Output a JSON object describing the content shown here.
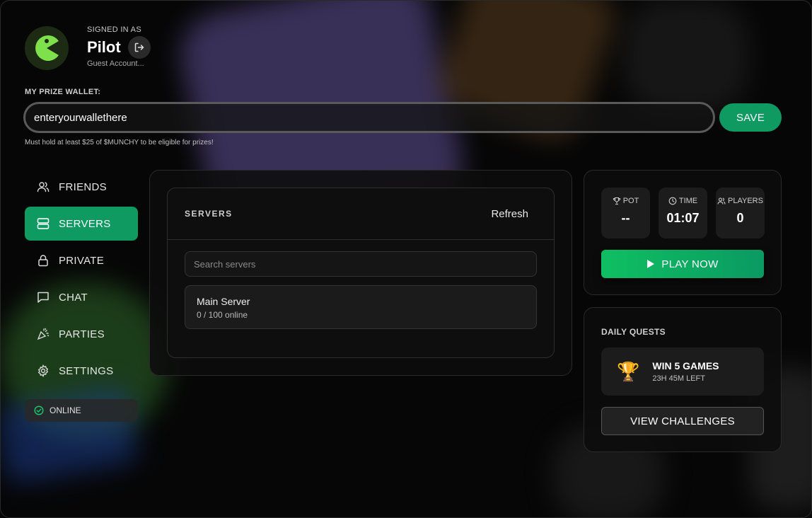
{
  "profile": {
    "signed_in_label": "SIGNED IN AS",
    "username": "Pilot",
    "account_type": "Guest Account...",
    "avatar_icon": "pacman-icon",
    "logout_icon": "logout-icon"
  },
  "wallet": {
    "label": "MY PRIZE WALLET:",
    "value": "enteryourwallethere",
    "save_label": "SAVE",
    "note": "Must hold at least $25 of $MUNCHY to be eligible for prizes!"
  },
  "sidebar": {
    "items": [
      {
        "label": "FRIENDS",
        "icon": "users-icon",
        "active": false
      },
      {
        "label": "SERVERS",
        "icon": "servers-icon",
        "active": true
      },
      {
        "label": "PRIVATE",
        "icon": "lock-icon",
        "active": false
      },
      {
        "label": "CHAT",
        "icon": "chat-icon",
        "active": false
      },
      {
        "label": "PARTIES",
        "icon": "party-icon",
        "active": false
      },
      {
        "label": "SETTINGS",
        "icon": "gear-icon",
        "active": false
      }
    ],
    "status": "ONLINE"
  },
  "servers": {
    "title": "SERVERS",
    "refresh_label": "Refresh",
    "search_placeholder": "Search servers",
    "list": [
      {
        "name": "Main Server",
        "online": "0 / 100 online"
      }
    ]
  },
  "game": {
    "stats": [
      {
        "label": "POT",
        "value": "--",
        "icon": "trophy-icon"
      },
      {
        "label": "TIME",
        "value": "01:07",
        "icon": "clock-icon"
      },
      {
        "label": "PLAYERS",
        "value": "0",
        "icon": "users-icon"
      }
    ],
    "play_label": "PLAY NOW"
  },
  "quests": {
    "title": "DAILY QUESTS",
    "items": [
      {
        "name": "WIN 5 GAMES",
        "time_left": "23H 45M LEFT",
        "icon": "trophy-icon"
      }
    ],
    "view_label": "VIEW CHALLENGES"
  },
  "colors": {
    "accent": "#0f9a62",
    "play_gradient_start": "#0fbf62",
    "avatar": "#7ee04a"
  }
}
